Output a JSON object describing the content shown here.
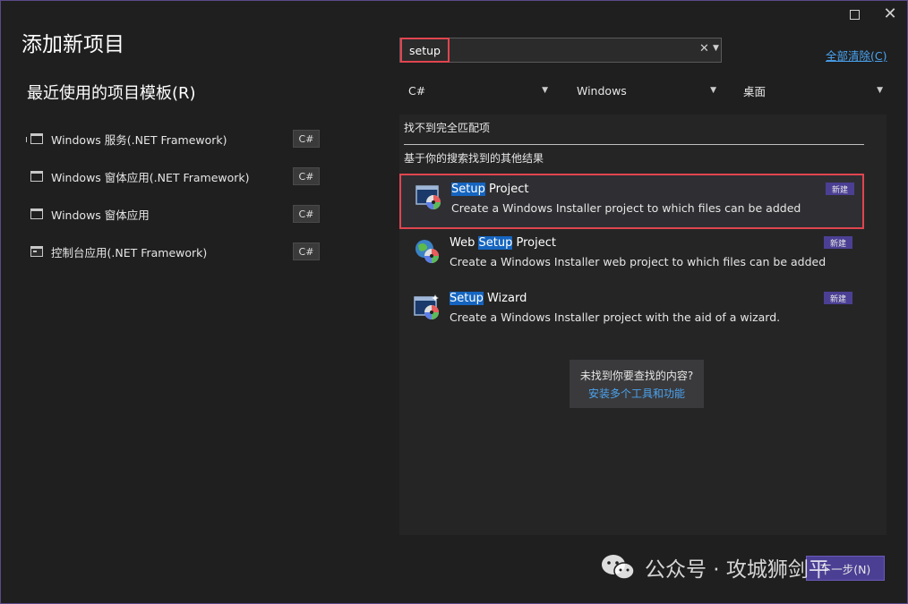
{
  "window": {
    "title": "添加新项目"
  },
  "recent": {
    "header": "最近使用的项目模板(R)",
    "items": [
      {
        "label": "Windows 服务(.NET Framework)",
        "lang": "C#",
        "icon": "service-icon"
      },
      {
        "label": "Windows 窗体应用(.NET Framework)",
        "lang": "C#",
        "icon": "window-form-icon"
      },
      {
        "label": "Windows 窗体应用",
        "lang": "C#",
        "icon": "window-form-icon"
      },
      {
        "label": "控制台应用(.NET Framework)",
        "lang": "C#",
        "icon": "console-icon"
      }
    ]
  },
  "search": {
    "value": "setup",
    "clear_label": "全部清除(C)"
  },
  "filters": {
    "language": "C#",
    "platform": "Windows",
    "project_type": "桌面"
  },
  "results": {
    "no_exact": "找不到完全匹配项",
    "other_results": "基于你的搜索找到的其他结果",
    "items": [
      {
        "prefix": "",
        "highlight": "Setup",
        "suffix": " Project",
        "desc": "Create a Windows Installer project to which files can be added",
        "badge": "新建",
        "selected": true
      },
      {
        "prefix": "Web ",
        "highlight": "Setup",
        "suffix": " Project",
        "desc": "Create a Windows Installer web project to which files can be added",
        "badge": "新建",
        "selected": false
      },
      {
        "prefix": "",
        "highlight": "Setup",
        "suffix": " Wizard",
        "desc": "Create a Windows Installer project with the aid of a wizard.",
        "badge": "新建",
        "selected": false
      }
    ]
  },
  "help": {
    "question": "未找到你要查找的内容?",
    "link": "安装多个工具和功能"
  },
  "footer": {
    "next_label": "下一步(N)",
    "watermark": "公众号 · 攻城狮剑平"
  },
  "colors": {
    "background": "#1f1f1f",
    "accent": "#4b3f94",
    "highlight": "#1565c0",
    "annotation_red": "#e0454f",
    "link": "#4aa3f0"
  }
}
